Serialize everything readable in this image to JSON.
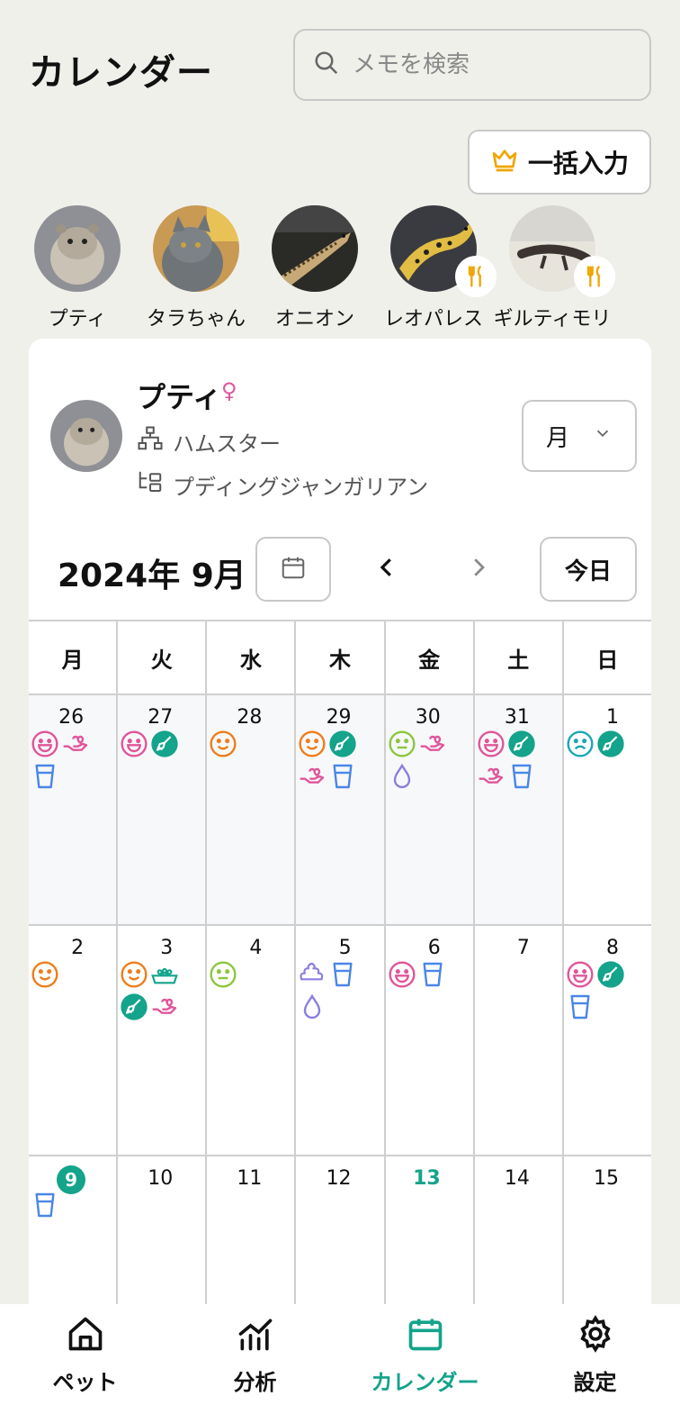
{
  "header": {
    "title": "カレンダー",
    "search_placeholder": "メモを検索",
    "bulk_button": "一括入力"
  },
  "pets": [
    {
      "name": "プティ",
      "has_fork_badge": false
    },
    {
      "name": "タラちゃん",
      "has_fork_badge": false
    },
    {
      "name": "オニオン",
      "has_fork_badge": false
    },
    {
      "name": "レオパレス",
      "has_fork_badge": true
    },
    {
      "name": "ギルティモリ",
      "has_fork_badge": true
    }
  ],
  "profile": {
    "name": "プティ",
    "gender": "♀",
    "species": "ハムスター",
    "breed": "プディングジャンガリアン",
    "period": "月"
  },
  "calendar": {
    "month_title": "2024年 9月",
    "today_button": "今日",
    "weekdays": [
      "月",
      "火",
      "水",
      "木",
      "金",
      "土",
      "日"
    ],
    "weeks": [
      [
        {
          "day": "26",
          "other": true,
          "icons": [
            "smile-big-pink",
            "hand-pink",
            "cup-blue"
          ]
        },
        {
          "day": "27",
          "other": true,
          "icons": [
            "smile-big-pink",
            "broom-teal"
          ]
        },
        {
          "day": "28",
          "other": true,
          "icons": [
            "smile-orange"
          ]
        },
        {
          "day": "29",
          "other": true,
          "icons": [
            "smile-orange",
            "broom-teal",
            "hand-pink",
            "cup-blue"
          ]
        },
        {
          "day": "30",
          "other": true,
          "icons": [
            "neutral-green",
            "hand-pink",
            "drop-purple"
          ]
        },
        {
          "day": "31",
          "other": true,
          "icons": [
            "smile-big-pink",
            "broom-teal",
            "hand-pink",
            "cup-blue"
          ]
        },
        {
          "day": "1",
          "other": false,
          "icons": [
            "sad-teal",
            "broom-teal"
          ]
        }
      ],
      [
        {
          "day": "2",
          "icons": [
            "smile-orange"
          ]
        },
        {
          "day": "3",
          "icons": [
            "smile-orange",
            "food-teal",
            "broom-teal",
            "hand-pink"
          ]
        },
        {
          "day": "4",
          "icons": [
            "neutral-green"
          ]
        },
        {
          "day": "5",
          "icons": [
            "poop-purple",
            "cup-blue",
            "drop-purple"
          ]
        },
        {
          "day": "6",
          "icons": [
            "smile-big-pink",
            "cup-blue"
          ]
        },
        {
          "day": "7",
          "icons": []
        },
        {
          "day": "8",
          "icons": [
            "smile-big-pink",
            "broom-teal",
            "cup-blue"
          ]
        }
      ],
      [
        {
          "day": "9",
          "selected": true,
          "icons": [
            "cup-blue"
          ]
        },
        {
          "day": "10",
          "icons": []
        },
        {
          "day": "11",
          "icons": []
        },
        {
          "day": "12",
          "icons": []
        },
        {
          "day": "13",
          "today": true,
          "icons": []
        },
        {
          "day": "14",
          "icons": []
        },
        {
          "day": "15",
          "icons": []
        }
      ]
    ]
  },
  "bottom_nav": [
    {
      "label": "ペット",
      "icon": "home-icon",
      "active": false
    },
    {
      "label": "分析",
      "icon": "chart-icon",
      "active": false
    },
    {
      "label": "カレンダー",
      "icon": "calendar-icon",
      "active": true
    },
    {
      "label": "設定",
      "icon": "gear-icon",
      "active": false
    }
  ],
  "colors": {
    "accent": "#14a38b",
    "pink": "#e0559a",
    "orange": "#ef7d1a",
    "green": "#8cc63f",
    "blue": "#4a86e8",
    "purple": "#8a7fe0",
    "gold": "#f0a500"
  }
}
